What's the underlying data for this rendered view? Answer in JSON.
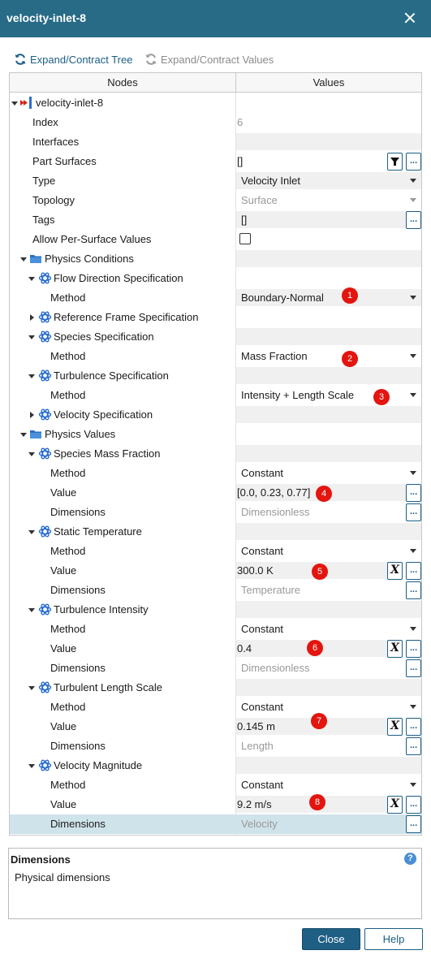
{
  "window": {
    "title": "velocity-inlet-8"
  },
  "toolbar": {
    "expand_tree": "Expand/Contract Tree",
    "expand_values": "Expand/Contract Values"
  },
  "grid": {
    "col_nodes": "Nodes",
    "col_values": "Values"
  },
  "rows": [
    {
      "label": "velocity-inlet-8"
    },
    {
      "label": "Index",
      "value": "6"
    },
    {
      "label": "Interfaces",
      "value": ""
    },
    {
      "label": "Part Surfaces",
      "value": "[]"
    },
    {
      "label": "Type",
      "value": "Velocity Inlet"
    },
    {
      "label": "Topology",
      "value": "Surface"
    },
    {
      "label": "Tags",
      "value": "[]"
    },
    {
      "label": "Allow Per-Surface Values"
    },
    {
      "label": "Physics Conditions"
    },
    {
      "label": "Flow Direction Specification"
    },
    {
      "label": "Method",
      "value": "Boundary-Normal"
    },
    {
      "label": "Reference Frame Specification"
    },
    {
      "label": "Species Specification"
    },
    {
      "label": "Method",
      "value": "Mass Fraction"
    },
    {
      "label": "Turbulence Specification"
    },
    {
      "label": "Method",
      "value": "Intensity + Length Scale"
    },
    {
      "label": "Velocity Specification"
    },
    {
      "label": "Physics Values"
    },
    {
      "label": "Species Mass Fraction"
    },
    {
      "label": "Method",
      "value": "Constant"
    },
    {
      "label": "Value",
      "value": "[0.0, 0.23, 0.77]"
    },
    {
      "label": "Dimensions",
      "value": "Dimensionless"
    },
    {
      "label": "Static Temperature"
    },
    {
      "label": "Method",
      "value": "Constant"
    },
    {
      "label": "Value",
      "value": "300.0 K"
    },
    {
      "label": "Dimensions",
      "value": "Temperature"
    },
    {
      "label": "Turbulence Intensity"
    },
    {
      "label": "Method",
      "value": "Constant"
    },
    {
      "label": "Value",
      "value": "0.4"
    },
    {
      "label": "Dimensions",
      "value": "Dimensionless"
    },
    {
      "label": "Turbulent Length Scale"
    },
    {
      "label": "Method",
      "value": "Constant"
    },
    {
      "label": "Value",
      "value": "0.145 m"
    },
    {
      "label": "Dimensions",
      "value": "Length"
    },
    {
      "label": "Velocity Magnitude"
    },
    {
      "label": "Method",
      "value": "Constant"
    },
    {
      "label": "Value",
      "value": "9.2 m/s"
    },
    {
      "label": "Dimensions",
      "value": "Velocity"
    }
  ],
  "badges": [
    "1",
    "2",
    "3",
    "4",
    "5",
    "6",
    "7",
    "8"
  ],
  "buttons": {
    "ellipsis": "...",
    "expression": "X"
  },
  "description": {
    "title": "Dimensions",
    "text": "Physical dimensions",
    "help_icon": "?"
  },
  "footer": {
    "close": "Close",
    "help": "Help"
  },
  "colors": {
    "titlebar": "#276b87",
    "accent": "#1b5e86",
    "badge": "#e3150e",
    "selected_row": "#cfe3ea"
  }
}
